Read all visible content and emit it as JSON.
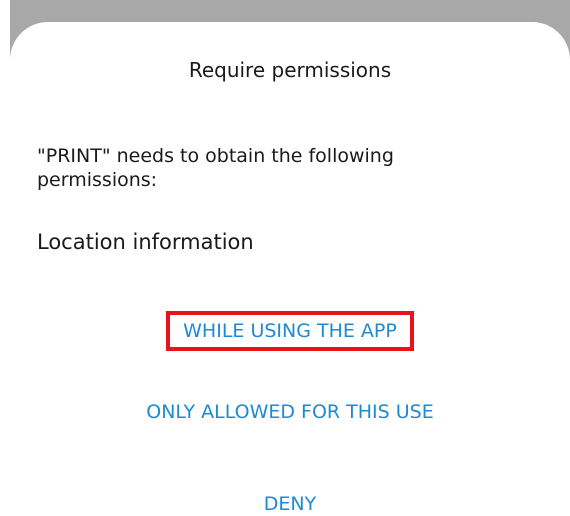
{
  "dialog": {
    "title": "Require permissions",
    "message": "\"PRINT\" needs to obtain the following permissions:",
    "permission_item": "Location information",
    "options": {
      "while_using": "WHILE USING THE APP",
      "only_this_use": "ONLY ALLOWED FOR THIS USE",
      "deny": "DENY"
    },
    "colors": {
      "accent": "#1f8ad4",
      "highlight_border": "#e8141c",
      "backdrop": "#a8a8a8",
      "text": "#1a1a1a"
    }
  }
}
